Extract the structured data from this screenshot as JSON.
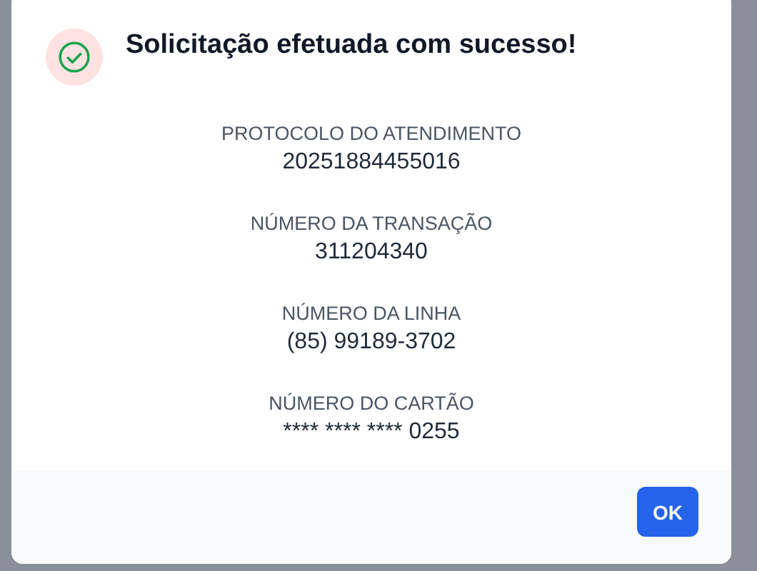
{
  "dialog": {
    "title": "Solicitação efetuada com sucesso!",
    "fields": [
      {
        "label": "PROTOCOLO DO ATENDIMENTO",
        "value": "20251884455016"
      },
      {
        "label": "NÚMERO DA TRANSAÇÃO",
        "value": "311204340"
      },
      {
        "label": "NÚMERO DA LINHA",
        "value": "(85) 99189-3702"
      },
      {
        "label": "NÚMERO DO CARTÃO",
        "value": "**** **** **** 0255"
      }
    ],
    "buttons": [
      "OK"
    ]
  }
}
